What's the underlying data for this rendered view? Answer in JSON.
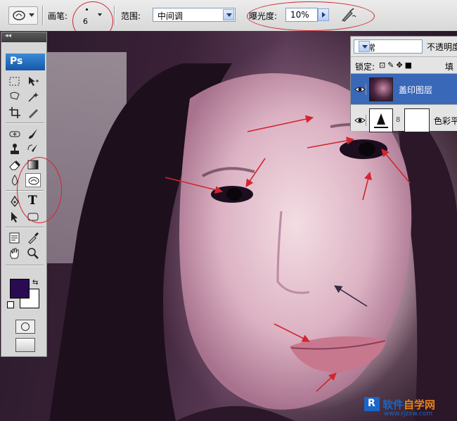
{
  "options_bar": {
    "tool_preset_icon": "dodge-tool-icon",
    "brush_label": "画笔:",
    "brush_size": "6",
    "range_label": "范围:",
    "range_value": "中间调",
    "exposure_label": "曝光度:",
    "exposure_value": "10%",
    "airbrush_icon": "airbrush-icon"
  },
  "toolbox": {
    "header": "◂◂",
    "app_badge": "Ps",
    "foreground_color": "#2a0b52",
    "background_color": "#ffffff",
    "tools": [
      "marquee-icon",
      "move-icon",
      "lasso-icon",
      "magic-wand-icon",
      "crop-icon",
      "slice-icon",
      "healing-brush-icon",
      "brush-icon",
      "clone-stamp-icon",
      "history-brush-icon",
      "eraser-icon",
      "gradient-icon",
      "blur-icon",
      "dodge-icon",
      "pen-icon",
      "type-icon",
      "path-selection-icon",
      "shape-icon",
      "notes-icon",
      "eyedropper-icon",
      "hand-icon",
      "zoom-icon"
    ],
    "type_tool_glyph": "T"
  },
  "layers": {
    "blend_mode": "正常",
    "opacity_label": "不透明度",
    "lock_label": "锁定:",
    "fill_label": "填充",
    "items": [
      {
        "name": "盖印图层",
        "selected": true
      },
      {
        "name": "色彩平衡",
        "selected": false
      }
    ]
  },
  "watermark": {
    "title_blue": "软件",
    "title_orange": "自学网",
    "url": "www.rjzxw.com"
  },
  "colors": {
    "annotation_red": "#d2262e",
    "selected_layer": "#3a68b8"
  }
}
